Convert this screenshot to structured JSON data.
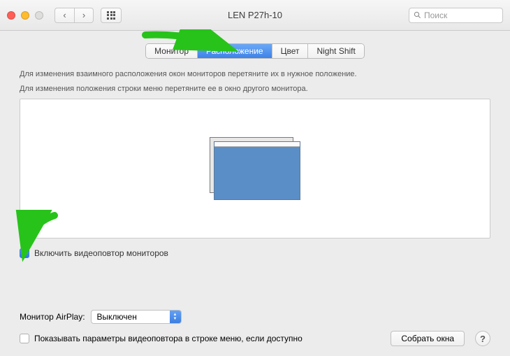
{
  "window_title": "LEN P27h-10",
  "search_placeholder": "Поиск",
  "tabs": [
    {
      "label": "Монитор",
      "active": false
    },
    {
      "label": "Расположение",
      "active": true
    },
    {
      "label": "Цвет",
      "active": false
    },
    {
      "label": "Night Shift",
      "active": false
    }
  ],
  "instructions": {
    "line1": "Для изменения взаимного расположения окон мониторов перетяните их в нужное положение.",
    "line2": "Для изменения положения строки меню перетяните ее в окно другого монитора."
  },
  "mirror_checkbox": {
    "checked": true,
    "label": "Включить видеоповтор мониторов"
  },
  "airplay": {
    "label": "Монитор AirPlay:",
    "value": "Выключен"
  },
  "show_mirror_menu": {
    "checked": false,
    "label": "Показывать параметры видеоповтора в строке меню, если доступно"
  },
  "gather_windows_label": "Собрать окна",
  "help_label": "?"
}
